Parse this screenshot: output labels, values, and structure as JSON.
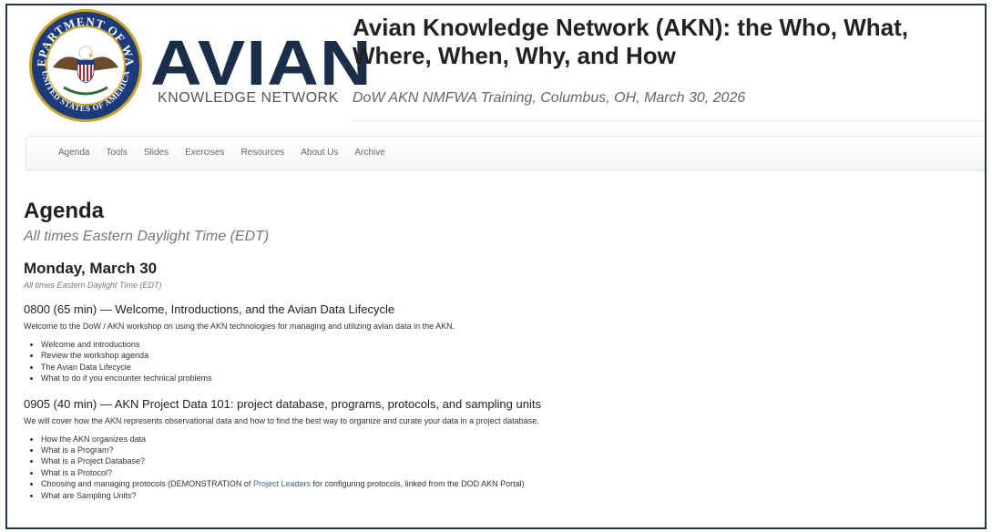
{
  "header": {
    "seal": {
      "top_text": "DEPARTMENT OF WAR",
      "bottom_text": "UNITED STATES OF AMERICA",
      "icon": "department-of-war-seal"
    },
    "logo": {
      "word": "AVIAN",
      "sub": "KNOWLEDGE NETWORK"
    },
    "title": "Avian Knowledge Network (AKN): the Who, What, Where, When, Why, and How",
    "subtitle": "DoW AKN NMFWA Training, Columbus, OH, March 30, 2026"
  },
  "nav": {
    "items": [
      "Agenda",
      "Tools",
      "Slides",
      "Exercises",
      "Resources",
      "About Us",
      "Archive"
    ]
  },
  "agenda": {
    "title": "Agenda",
    "timezone": "All times Eastern Daylight Time (EDT)",
    "day": {
      "title": "Monday, March 30",
      "timezone": "All times Eastern Daylight Time (EDT)"
    },
    "sessions": [
      {
        "title": "0800 (65 min) — Welcome, Introductions, and the Avian Data Lifecycle",
        "description": "Welcome to the DoW / AKN workshop on using the AKN technologies for managing and utilizing avian data in the AKN.",
        "bullets": [
          "Welcome and introductions",
          "Review the workshop agenda",
          "The Avian Data Lifecycle",
          "What to do if you encounter technical problems"
        ]
      },
      {
        "title": "0905 (40 min) — AKN Project Data 101: project database, programs, protocols, and sampling units",
        "description": "We will cover how the AKN represents observational data and how to find the best way to organize and curate your data in a project database.",
        "bullets": [
          "How the AKN organizes data",
          "What is a Program?",
          "What is a Project Database?",
          "What is a Protocol?"
        ],
        "link_bullet": {
          "before": "Choosing and managing protocols (DEMONSTRATION of ",
          "link": "Project Leaders",
          "after": " for configuring protocols, linked from the DOD AKN Portal)"
        },
        "last_bullet": "What are Sampling Units?"
      }
    ]
  },
  "colors": {
    "frame_border": "#1f3650",
    "logo_navy": "#1a2e4a",
    "link": "#2a6db0",
    "seal_blue": "#1d3a7a",
    "seal_gold": "#c9a227"
  }
}
